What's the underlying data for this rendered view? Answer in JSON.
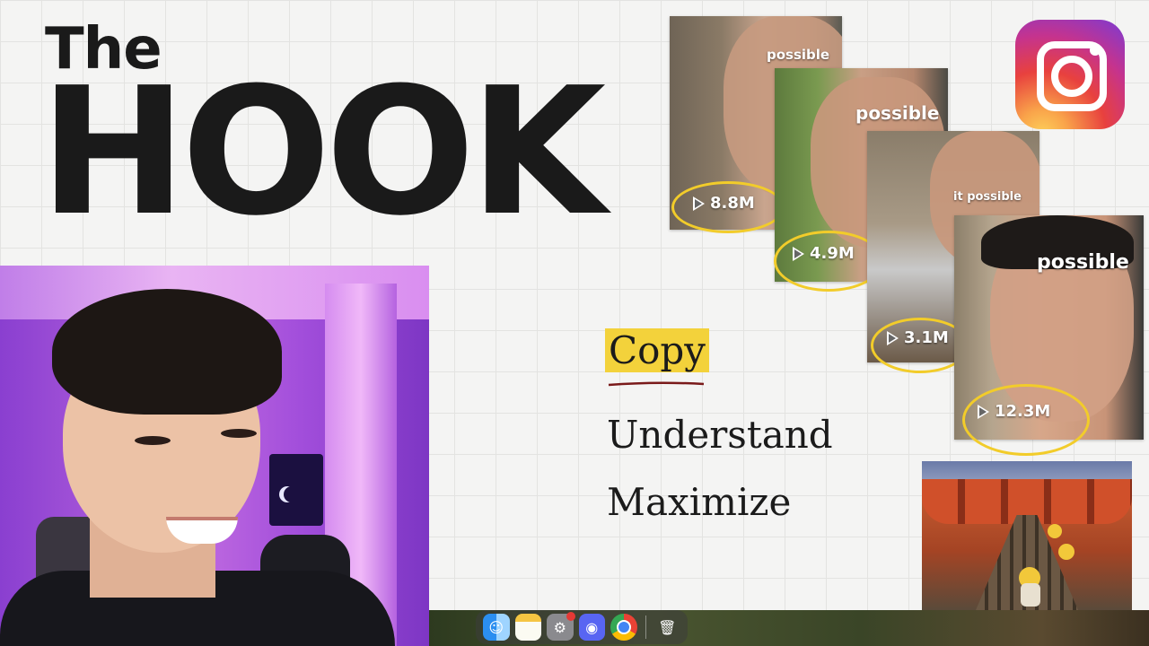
{
  "title": {
    "line1": "The",
    "line2": "HOOK"
  },
  "thumbnails": [
    {
      "caption": "possible",
      "views": "8.8M"
    },
    {
      "caption": "possible",
      "views": "4.9M"
    },
    {
      "caption": "it possible",
      "views": "3.1M"
    },
    {
      "caption": "possible",
      "views": "12.3M"
    }
  ],
  "steps": [
    "Copy",
    "Understand",
    "Maximize"
  ],
  "icons": {
    "instagram": "instagram-logo-icon",
    "play": "play-icon",
    "dock": [
      "finder-icon",
      "notes-icon",
      "system-settings-icon",
      "discord-icon",
      "chrome-icon",
      "trash-icon"
    ]
  },
  "colors": {
    "circle": "#f2cc2a",
    "highlight": "#f3d23b",
    "text": "#1a1a1a",
    "webcam_light": "#a24edb"
  }
}
